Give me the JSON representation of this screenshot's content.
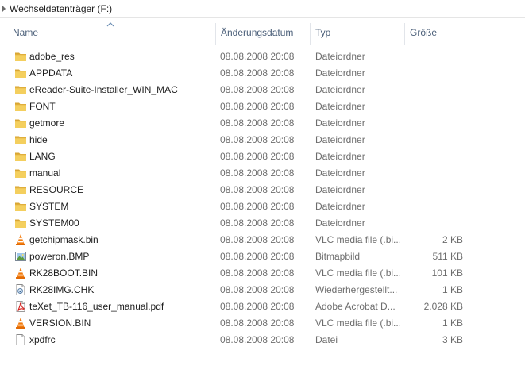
{
  "breadcrumb": {
    "label": "Wechseldatenträger (F:)"
  },
  "columns": {
    "name": "Name",
    "date": "Änderungsdatum",
    "type": "Typ",
    "size": "Größe"
  },
  "files": [
    {
      "name": "adobe_res",
      "date": "08.08.2008 20:08",
      "type": "Dateiordner",
      "size": "",
      "icon": "folder-icon"
    },
    {
      "name": "APPDATA",
      "date": "08.08.2008 20:08",
      "type": "Dateiordner",
      "size": "",
      "icon": "folder-icon"
    },
    {
      "name": "eReader-Suite-Installer_WIN_MAC",
      "date": "08.08.2008 20:08",
      "type": "Dateiordner",
      "size": "",
      "icon": "folder-icon"
    },
    {
      "name": "FONT",
      "date": "08.08.2008 20:08",
      "type": "Dateiordner",
      "size": "",
      "icon": "folder-icon"
    },
    {
      "name": "getmore",
      "date": "08.08.2008 20:08",
      "type": "Dateiordner",
      "size": "",
      "icon": "folder-icon"
    },
    {
      "name": "hide",
      "date": "08.08.2008 20:08",
      "type": "Dateiordner",
      "size": "",
      "icon": "folder-icon"
    },
    {
      "name": "LANG",
      "date": "08.08.2008 20:08",
      "type": "Dateiordner",
      "size": "",
      "icon": "folder-icon"
    },
    {
      "name": "manual",
      "date": "08.08.2008 20:08",
      "type": "Dateiordner",
      "size": "",
      "icon": "folder-icon"
    },
    {
      "name": "RESOURCE",
      "date": "08.08.2008 20:08",
      "type": "Dateiordner",
      "size": "",
      "icon": "folder-icon"
    },
    {
      "name": "SYSTEM",
      "date": "08.08.2008 20:08",
      "type": "Dateiordner",
      "size": "",
      "icon": "folder-icon"
    },
    {
      "name": "SYSTEM00",
      "date": "08.08.2008 20:08",
      "type": "Dateiordner",
      "size": "",
      "icon": "folder-icon"
    },
    {
      "name": "getchipmask.bin",
      "date": "08.08.2008 20:08",
      "type": "VLC media file (.bi...",
      "size": "2 KB",
      "icon": "vlc-cone-icon"
    },
    {
      "name": "poweron.BMP",
      "date": "08.08.2008 20:08",
      "type": "Bitmapbild",
      "size": "511 KB",
      "icon": "bitmap-image-icon"
    },
    {
      "name": "RK28BOOT.BIN",
      "date": "08.08.2008 20:08",
      "type": "VLC media file (.bi...",
      "size": "101 KB",
      "icon": "vlc-cone-icon"
    },
    {
      "name": "RK28IMG.CHK",
      "date": "08.08.2008 20:08",
      "type": "Wiederhergestellt...",
      "size": "1 KB",
      "icon": "recovered-file-icon"
    },
    {
      "name": "teXet_TB-116_user_manual.pdf",
      "date": "08.08.2008 20:08",
      "type": "Adobe Acrobat D...",
      "size": "2.028 KB",
      "icon": "pdf-icon"
    },
    {
      "name": "VERSION.BIN",
      "date": "08.08.2008 20:08",
      "type": "VLC media file (.bi...",
      "size": "1 KB",
      "icon": "vlc-cone-icon"
    },
    {
      "name": "xpdfrc",
      "date": "08.08.2008 20:08",
      "type": "Datei",
      "size": "3 KB",
      "icon": "blank-file-icon"
    }
  ]
}
